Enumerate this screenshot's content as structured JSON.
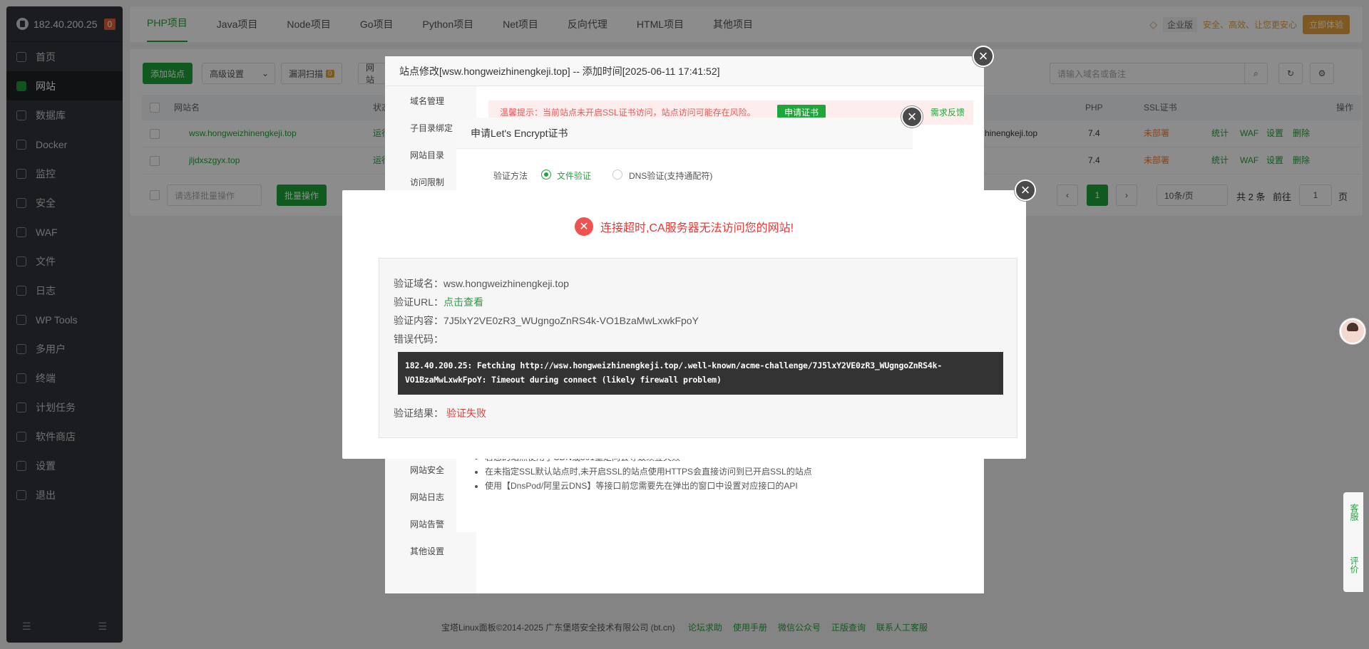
{
  "sidebar": {
    "ip": "182.40.200.25",
    "badge": "0",
    "items": [
      {
        "label": "首页",
        "icon": "home-icon"
      },
      {
        "label": "网站",
        "icon": "globe-icon"
      },
      {
        "label": "数据库",
        "icon": "database-icon"
      },
      {
        "label": "Docker",
        "icon": "docker-icon"
      },
      {
        "label": "监控",
        "icon": "monitor-icon"
      },
      {
        "label": "安全",
        "icon": "shield-icon"
      },
      {
        "label": "WAF",
        "icon": "firewall-icon"
      },
      {
        "label": "文件",
        "icon": "folder-icon"
      },
      {
        "label": "日志",
        "icon": "log-icon"
      },
      {
        "label": "WP Tools",
        "icon": "wordpress-icon"
      },
      {
        "label": "多用户",
        "icon": "users-icon"
      },
      {
        "label": "终端",
        "icon": "terminal-icon"
      },
      {
        "label": "计划任务",
        "icon": "clock-icon"
      },
      {
        "label": "软件商店",
        "icon": "store-icon"
      },
      {
        "label": "设置",
        "icon": "gear-icon"
      },
      {
        "label": "退出",
        "icon": "logout-icon"
      }
    ]
  },
  "topbar": {
    "tabs": [
      "PHP项目",
      "Java项目",
      "Node项目",
      "Go项目",
      "Python项目",
      "Net项目",
      "反向代理",
      "HTML项目",
      "其他项目"
    ],
    "vip": "企业版",
    "slogan": "安全、高效、让您更安心",
    "try": "立即体验"
  },
  "toolbar": {
    "add_site": "添加站点",
    "advanced": "高级设置",
    "vuln_scan": "漏洞扫描",
    "vuln_count": "0",
    "site_partial": "网站",
    "search_placeholder": "请输入域名或备注"
  },
  "table": {
    "headers": {
      "name": "网站名",
      "status": "状态",
      "php": "PHP",
      "ssl": "SSL证书",
      "ops": "操作"
    },
    "rows": [
      {
        "name": "wsw.hongweizhinengkeji.top",
        "status": "运行",
        "domain_tail": "hinengkeji.top",
        "php": "7.4",
        "ssl": "未部署"
      },
      {
        "name": "jljdxszgyx.top",
        "status": "运行",
        "domain_tail": "",
        "php": "7.4",
        "ssl": "未部署"
      }
    ],
    "row_ops": [
      "统计",
      "WAF",
      "设置",
      "删除"
    ]
  },
  "pager": {
    "batch_placeholder": "请选择批量操作",
    "batch_btn": "批量操作",
    "current": "1",
    "page_size": "10条/页",
    "total": "共 2 条",
    "goto": "前往",
    "goto_value": "1",
    "page_unit": "页"
  },
  "site_dialog": {
    "title": "站点修改[wsw.hongweizhinengkeji.top] -- 添加时间[2025-06-11 17:41:52]",
    "nav": [
      "域名管理",
      "子目录绑定",
      "网站目录",
      "访问限制",
      "网站安全",
      "网站日志",
      "网站告警",
      "其他设置"
    ],
    "tip": "温馨提示：当前站点未开启SSL证书访问，站点访问可能存在风险。",
    "apply_btn": "申请证书",
    "feedback": "需求反馈"
  },
  "le_dialog": {
    "title": "申请Let's Encrypt证书",
    "verify_label": "验证方法",
    "file_verify": "文件验证",
    "dns_verify": "DNS验证(支持通配符)",
    "notes": [
      "若您的站点使用了CDN或301重定向会导致续签失败",
      "在未指定SSL默认站点时,未开启SSL的站点使用HTTPS会直接访问到已开启SSL的站点",
      "使用【DnsPod/阿里云DNS】等接口前您需要先在弹出的窗口中设置对应接口的API"
    ]
  },
  "error_dialog": {
    "message": "连接超时,CA服务器无法访问您的网站!",
    "domain_label": "验证域名：",
    "domain": "wsw.hongweizhinengkeji.top",
    "url_label": "验证URL：",
    "url_link": "点击查看",
    "content_label": "验证内容：",
    "content": "7J5lxY2VE0zR3_WUgngoZnRS4k-VO1BzaMwLxwkFpoY",
    "errcode_label": "错误代码：",
    "code_line1": "182.40.200.25: Fetching http://wsw.hongweizhinengkeji.top/.well-known/acme-challenge/7J5lxY2VE0zR3_WUgngoZnRS4k-",
    "code_line2": "VO1BzaMwLxwkFpoY: Timeout during connect (likely firewall problem)",
    "result_label": "验证结果：",
    "result": "验证失败"
  },
  "footer": {
    "copyright": "宝塔Linux面板©2014-2025 广东堡塔安全技术有限公司 (bt.cn)",
    "links": [
      "论坛求助",
      "使用手册",
      "微信公众号",
      "正版查询",
      "联系人工客服"
    ]
  },
  "side_tools": [
    "客服",
    "评价"
  ],
  "colors": {
    "brand": "#20a53a",
    "error": "#e53935",
    "warning": "#ff7c2a"
  }
}
